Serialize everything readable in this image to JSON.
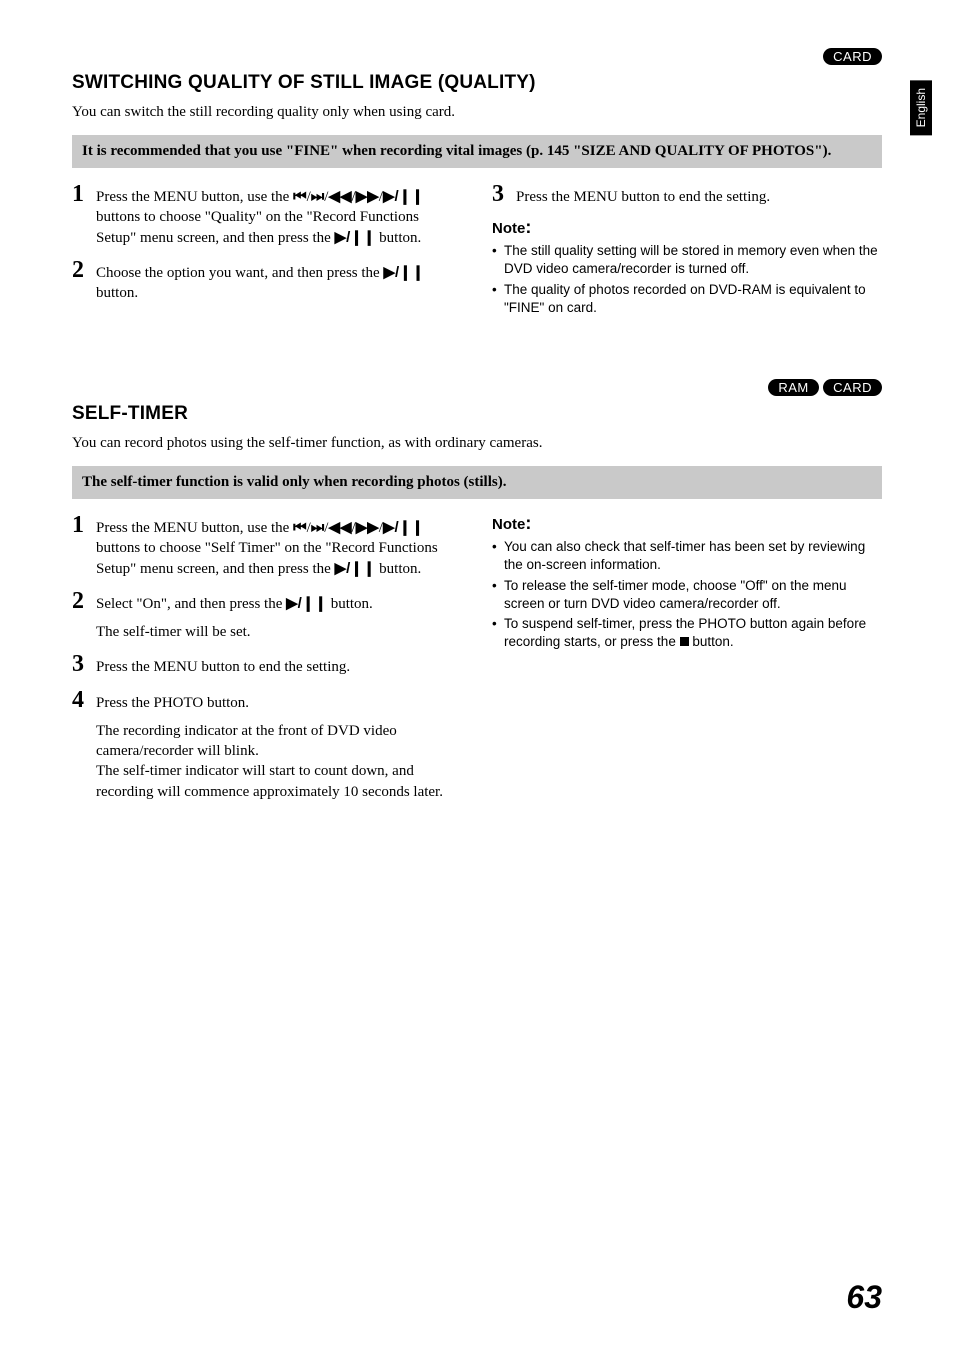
{
  "side_tab": "English",
  "badges": {
    "card": "CARD",
    "ram": "RAM"
  },
  "section1": {
    "title": "SWITCHING QUALITY OF STILL IMAGE (QUALITY)",
    "intro": "You can switch the still recording quality only when using card.",
    "highlight": "It is recommended that you use \"FINE\" when recording vital images (p. 145 \"SIZE AND QUALITY OF PHOTOS\").",
    "steps": {
      "s1a": "Press the MENU button, use the ",
      "s1b": " buttons to choose \"Quality\" on the \"Record Functions Setup\" menu screen, and then press the ",
      "s1c": " button.",
      "s2a": "Choose the option you want, and then press the ",
      "s2b": " button.",
      "s3": "Press the MENU button to end the setting."
    },
    "note_head": "Note",
    "notes": [
      "The still quality setting will be stored in memory even when the DVD video camera/recorder is turned off.",
      "The quality of photos recorded on DVD-RAM is equivalent to \"FINE\" on card."
    ]
  },
  "section2": {
    "title": "SELF-TIMER",
    "intro": "You can record photos using the self-timer function, as with ordinary cameras.",
    "highlight": "The self-timer function is valid only when recording photos (stills).",
    "steps": {
      "s1a": "Press the MENU button, use the ",
      "s1b": " buttons to choose \"Self Timer\" on the \"Record Functions Setup\" menu screen, and then press the ",
      "s1c": " button.",
      "s2a": "Select \"On\", and then press the ",
      "s2b": " button.",
      "s2sub": "The self-timer will be set.",
      "s3": "Press the MENU button to end the setting.",
      "s4a": "Press the PHOTO button.",
      "s4sub": "The recording indicator at the front of DVD video camera/recorder will blink.\nThe self-timer indicator will start to count down, and recording will commence approximately 10 seconds later."
    },
    "note_head": "Note",
    "notes": [
      "You can also check that self-timer has been set by reviewing the on-screen information.",
      "To release the self-timer mode, choose \"Off\" on the menu screen or turn DVD video camera/recorder off.",
      "To suspend self-timer, press the PHOTO button again before recording starts, or press the ■ button."
    ]
  },
  "page_number": "63",
  "glyphs": {
    "prev": "⏮",
    "next": "⏭",
    "rew": "◀◀",
    "ff": "▶▶",
    "playpause": "▶/❙❙"
  }
}
